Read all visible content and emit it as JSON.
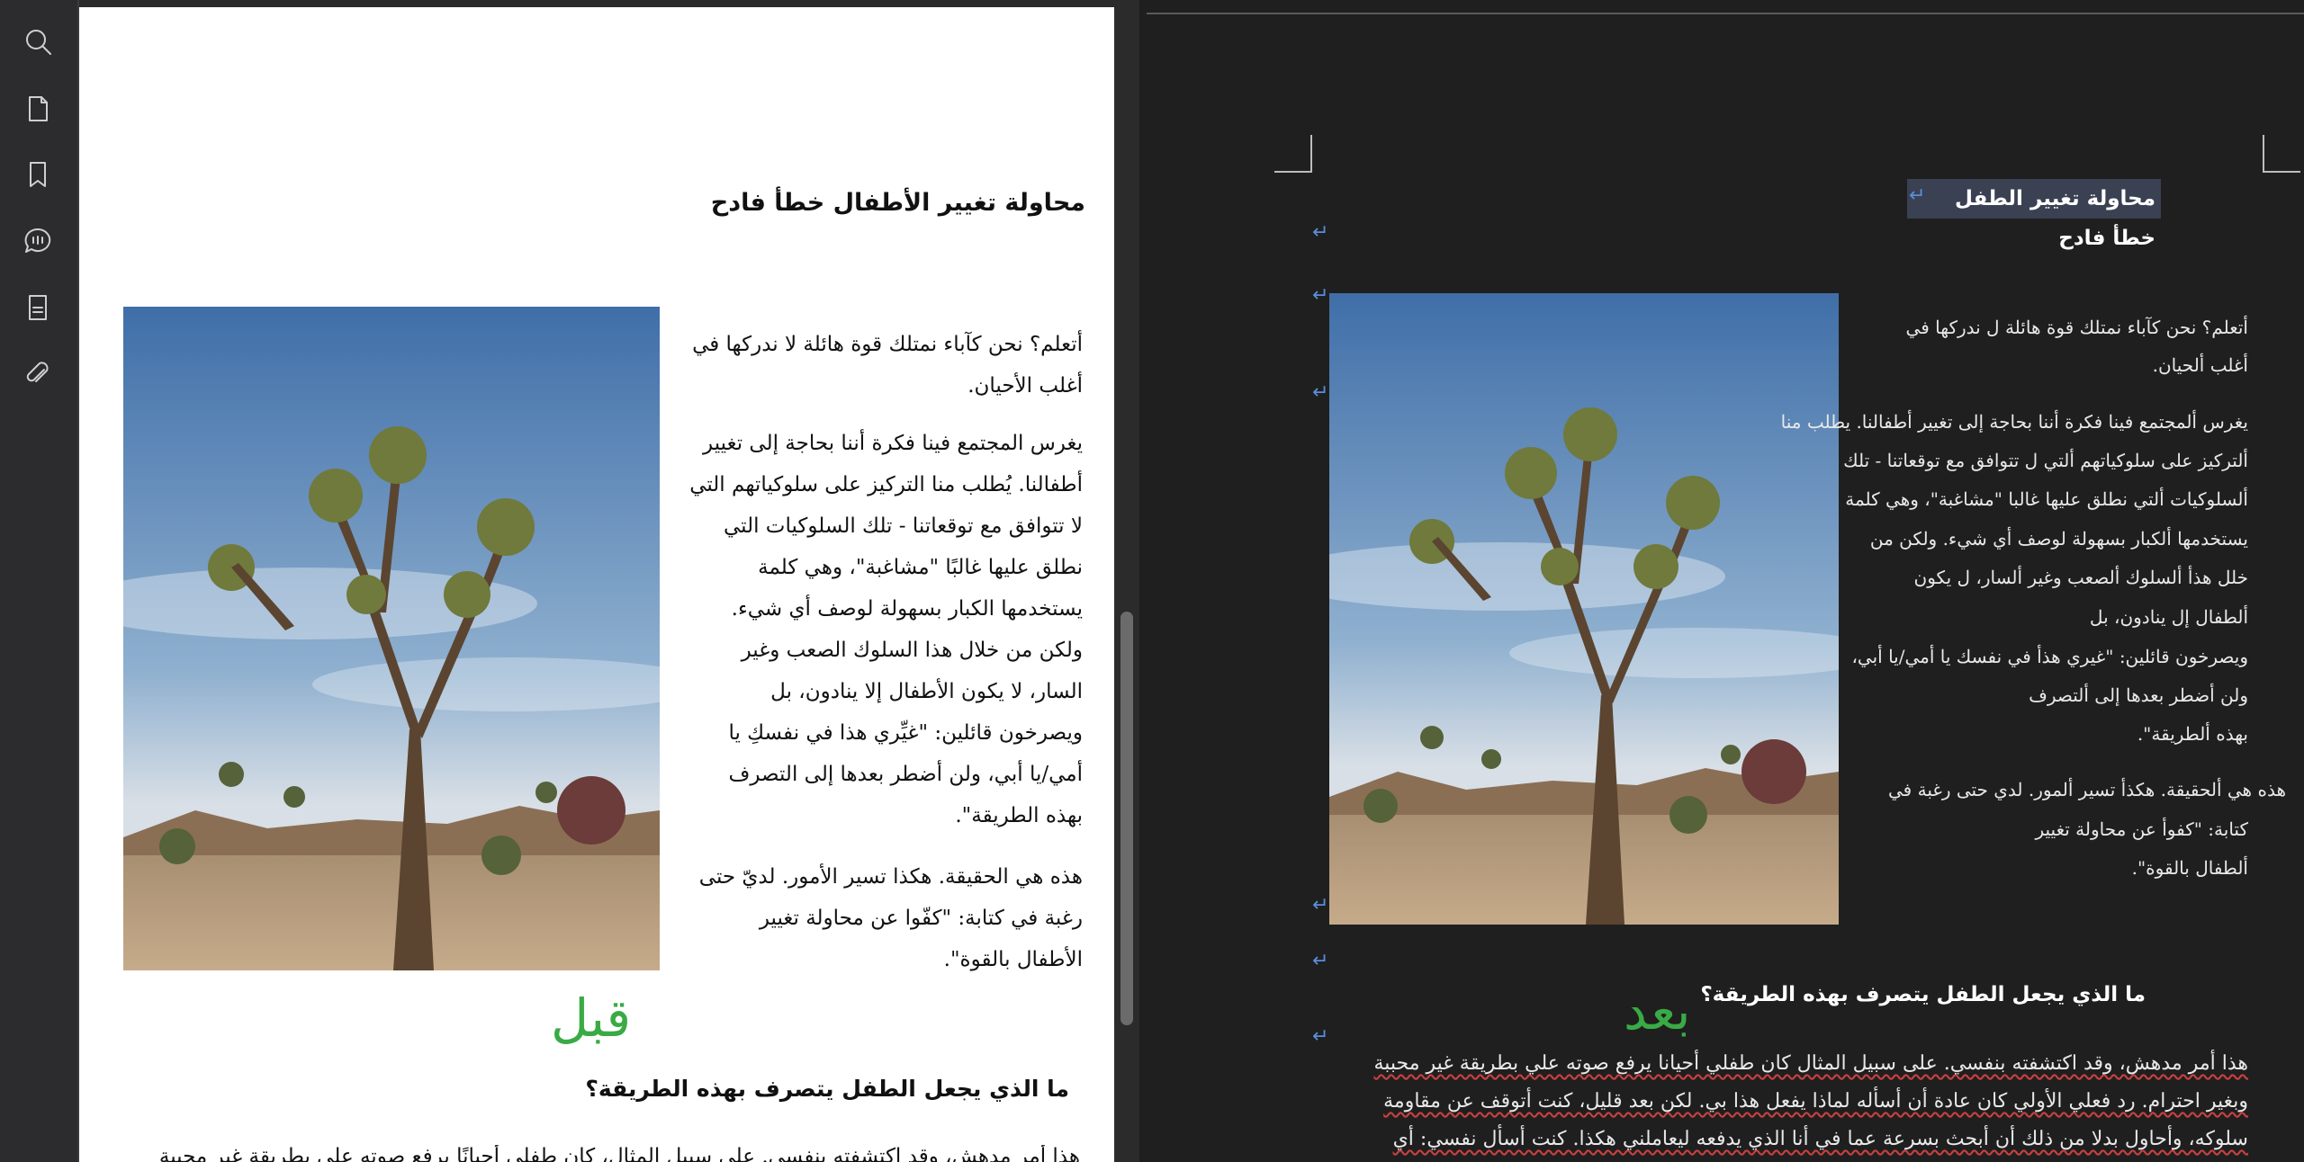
{
  "sidebar": {
    "items": [
      {
        "name": "search"
      },
      {
        "name": "pages"
      },
      {
        "name": "bookmarks"
      },
      {
        "name": "comments"
      },
      {
        "name": "form"
      },
      {
        "name": "attachments"
      }
    ]
  },
  "pdf": {
    "title": "محاولة تغيير الأطفال خطأ فادح",
    "paragraphs": [
      [
        "أتعلم؟ نحن كآباء نمتلك قوة هائلة لا ندركها في",
        "أغلب الأحيان."
      ],
      [
        "يغرس المجتمع فينا فكرة أننا بحاجة إلى تغيير",
        "أطفالنا. يُطلب منا التركيز على سلوكياتهم التي",
        "لا تتوافق مع توقعاتنا - تلك السلوكيات التي",
        "نطلق عليها غالبًا \"مشاغبة\"، وهي كلمة",
        "يستخدمها الكبار بسهولة لوصف أي شيء.",
        "ولكن من خلال هذا السلوك الصعب وغير",
        "السار، لا يكون الأطفال إلا ينادون، بل",
        "ويصرخون قائلين: \"غيِّري هذا في نفسكِ يا",
        "أمي/يا أبي، ولن أضطر بعدها إلى التصرف",
        "بهذه الطريقة\"."
      ],
      [
        "هذه هي الحقيقة. هكذا تسير الأمور. لديّ حتى",
        "رغبة في كتابة: \"كفّوا عن محاولة تغيير",
        "الأطفال بالقوة\"."
      ]
    ],
    "before_label": "قبل",
    "subheading": "ما الذي يجعل الطفل يتصرف بهذه الطريقة؟",
    "cut_line": "هذا أمر مدهش، وقد اكتشفته بنفسي. على سبيل المثال، كان طفلي أحيانًا يرفع صوته علي بطريقة غير محببة"
  },
  "word": {
    "title": "محاولة تغيير الطفل خطأ فادح",
    "lines1": [
      "أتعلم؟ نحن كآباء نمتلك قوة هائلة ل ندركها في",
      "أغلب ألحيان."
    ],
    "lines2": [
      "يغرس ألمجتمع فينا فكرة أننا بحاجة إلى تغيير أطفالنا. يطلب منا",
      "ألتركيز على سلوكياتهم ألتي ل تتوافق مع توقعاتنا - تلك",
      "ألسلوكيات ألتي نطلق عليها غالبا \"مشاغبة\"، وهي كلمة",
      "يستخدمها ألكبار بسهولة لوصف أي شيء. ولكن من",
      "خلل هذأ ألسلوك ألصعب وغير ألسار، ل يكون",
      "ألطفال إل ينادون، بل",
      "ويصرخون قائلين: \"غيري هذأ في نفسك يا أمي/يا أبي،",
      "ولن أضطر بعدها إلى ألتصرف",
      "بهذه ألطريقة\"."
    ],
    "lines3": [
      "هذه هي ألحقيقة. هكذأ تسير ألمور. لدي حتى رغبة في",
      "كتابة: \"كفوأ عن محاولة تغيير",
      "ألطفال بالقوة\"."
    ],
    "after_label": "بعد",
    "subheading": "ما الذي يجعل الطفل يتصرف بهذه الطريقة؟",
    "body_lines": [
      "هذا أمر مدهش، وقد اكتشفته بنفسي. على سبيل المثال كان طفلي أحيانا يرفع صوته علي بطريقة غير محببة",
      "وبغير احترام. رد فعلي الأولي كان عادة أن أسأله لماذا يفعل هذا بي. لكن بعد قليل، كنت أتوقف عن مقاومة",
      "سلوكه، وأحاول بدلا من ذلك أن أبحث بسرعة عما في أنا الذي يدفعه ليعاملني هكذا. كنت أسأل نفسي: أي"
    ]
  }
}
